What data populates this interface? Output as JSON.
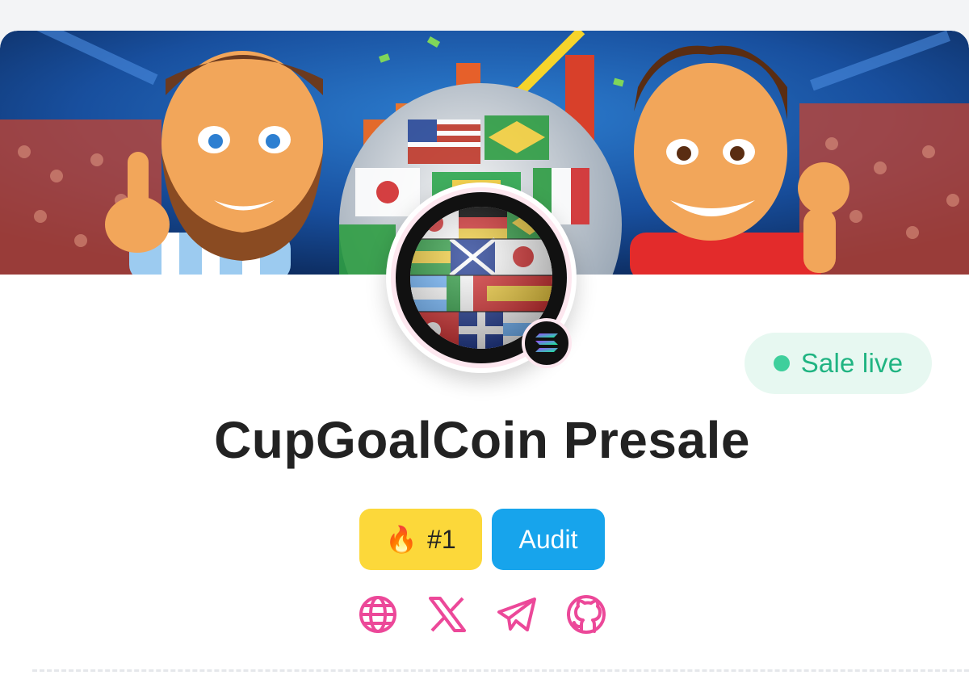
{
  "project": {
    "title": "CupGoalCoin Presale",
    "status": {
      "label": "Sale live",
      "color": "#20b482",
      "dot_color": "#3fcf9c"
    },
    "chain_icon": "solana-icon"
  },
  "badges": {
    "rank": {
      "emoji": "🔥",
      "label": "#1",
      "color": "#fcd83a"
    },
    "audit": {
      "label": "Audit",
      "color": "#17a4ec"
    }
  },
  "socials": [
    "globe-icon",
    "x-icon",
    "telegram-icon",
    "github-icon"
  ],
  "colors": {
    "accent": "#ec4899",
    "background": "#ffffff",
    "page": "#f3f4f6"
  }
}
